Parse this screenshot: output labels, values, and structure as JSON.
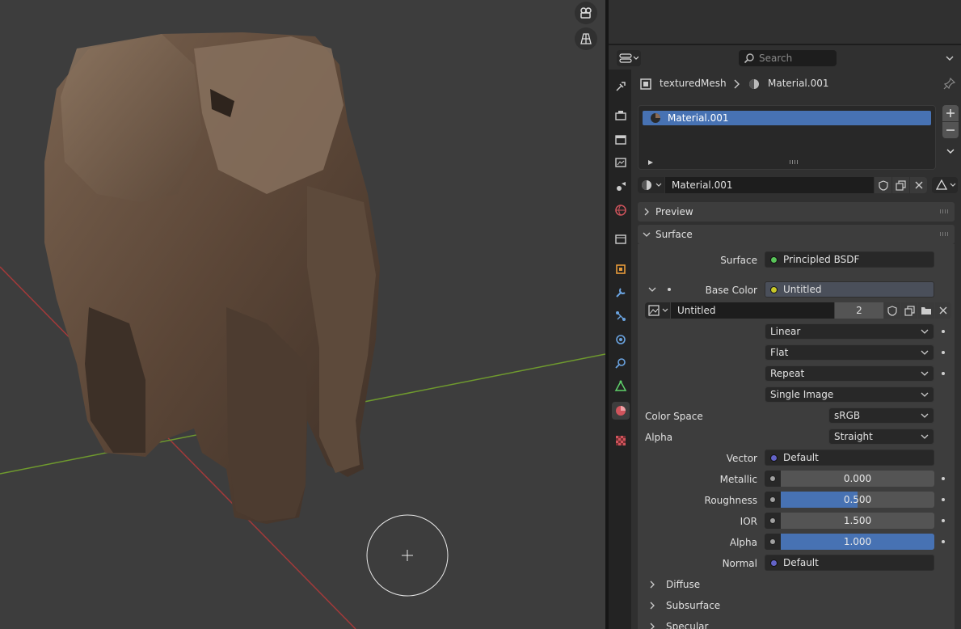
{
  "header": {
    "search_placeholder": "Search",
    "breadcrumb": {
      "object": "texturedMesh",
      "material": "Material.001"
    }
  },
  "material_slots": [
    {
      "name": "Material.001",
      "selected": true
    }
  ],
  "material_selector": {
    "name": "Material.001"
  },
  "panels": {
    "preview": "Preview",
    "surface": "Surface",
    "diffuse": "Diffuse",
    "subsurface": "Subsurface",
    "specular": "Specular"
  },
  "surface": {
    "surface_label": "Surface",
    "surface_value": "Principled BSDF",
    "base_color_label": "Base Color",
    "base_color_value": "Untitled",
    "image": {
      "name": "Untitled",
      "users": "2"
    },
    "interpolation": "Linear",
    "projection": "Flat",
    "extension": "Repeat",
    "source": "Single Image",
    "color_space_label": "Color Space",
    "color_space_value": "sRGB",
    "alpha_mode_label": "Alpha",
    "alpha_mode_value": "Straight",
    "vector_label": "Vector",
    "vector_value": "Default",
    "metallic_label": "Metallic",
    "metallic_value": "0.000",
    "metallic_fraction": 0.0,
    "roughness_label": "Roughness",
    "roughness_value": "0.500",
    "roughness_fraction": 0.5,
    "ior_label": "IOR",
    "ior_value": "1.500",
    "ior_fraction": 0.0,
    "alpha_label": "Alpha",
    "alpha_value": "1.000",
    "alpha_fraction": 1.0,
    "normal_label": "Normal",
    "normal_value": "Default"
  },
  "colors": {
    "accent": "#4772b3",
    "viewport_bg": "#3d3d3d",
    "x_axis": "#a33a3a",
    "y_axis": "#6f9a2e",
    "shader_socket": "#59c459",
    "color_socket": "#c7c729",
    "vector_socket": "#6363c7"
  },
  "tab_icons": [
    "tool-icon",
    "render-icon",
    "output-icon",
    "view-layer-icon",
    "scene-icon",
    "world-icon",
    "collection-icon",
    "object-icon",
    "modifier-icon",
    "particles-icon",
    "physics-icon",
    "constraints-icon",
    "data-icon",
    "material-icon",
    "texture-icon"
  ]
}
